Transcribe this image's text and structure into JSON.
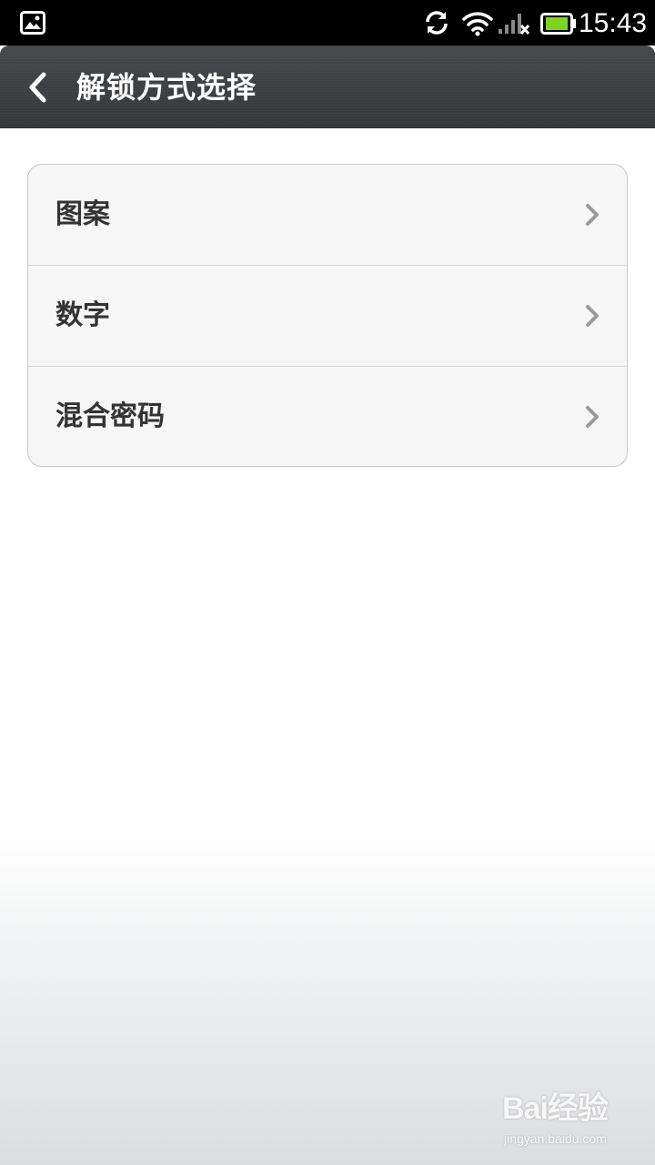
{
  "status_bar": {
    "time": "15:43",
    "icons": [
      "gallery-icon",
      "sync-icon",
      "wifi-icon",
      "signal-icon",
      "battery-icon"
    ],
    "battery_color": "#7ed321"
  },
  "header": {
    "title": "解锁方式选择",
    "back_icon": "chevron-left-icon"
  },
  "options": [
    {
      "label": "图案",
      "icon": "chevron-right-icon"
    },
    {
      "label": "数字",
      "icon": "chevron-right-icon"
    },
    {
      "label": "混合密码",
      "icon": "chevron-right-icon"
    }
  ],
  "watermark": {
    "brand": "Bai经验",
    "url": "jingyan.baidu.com"
  },
  "colors": {
    "header_bg": "#3a3c40",
    "card_bg": "#f6f6f6",
    "label_text": "#333333",
    "chevron": "#9a9a9a"
  }
}
